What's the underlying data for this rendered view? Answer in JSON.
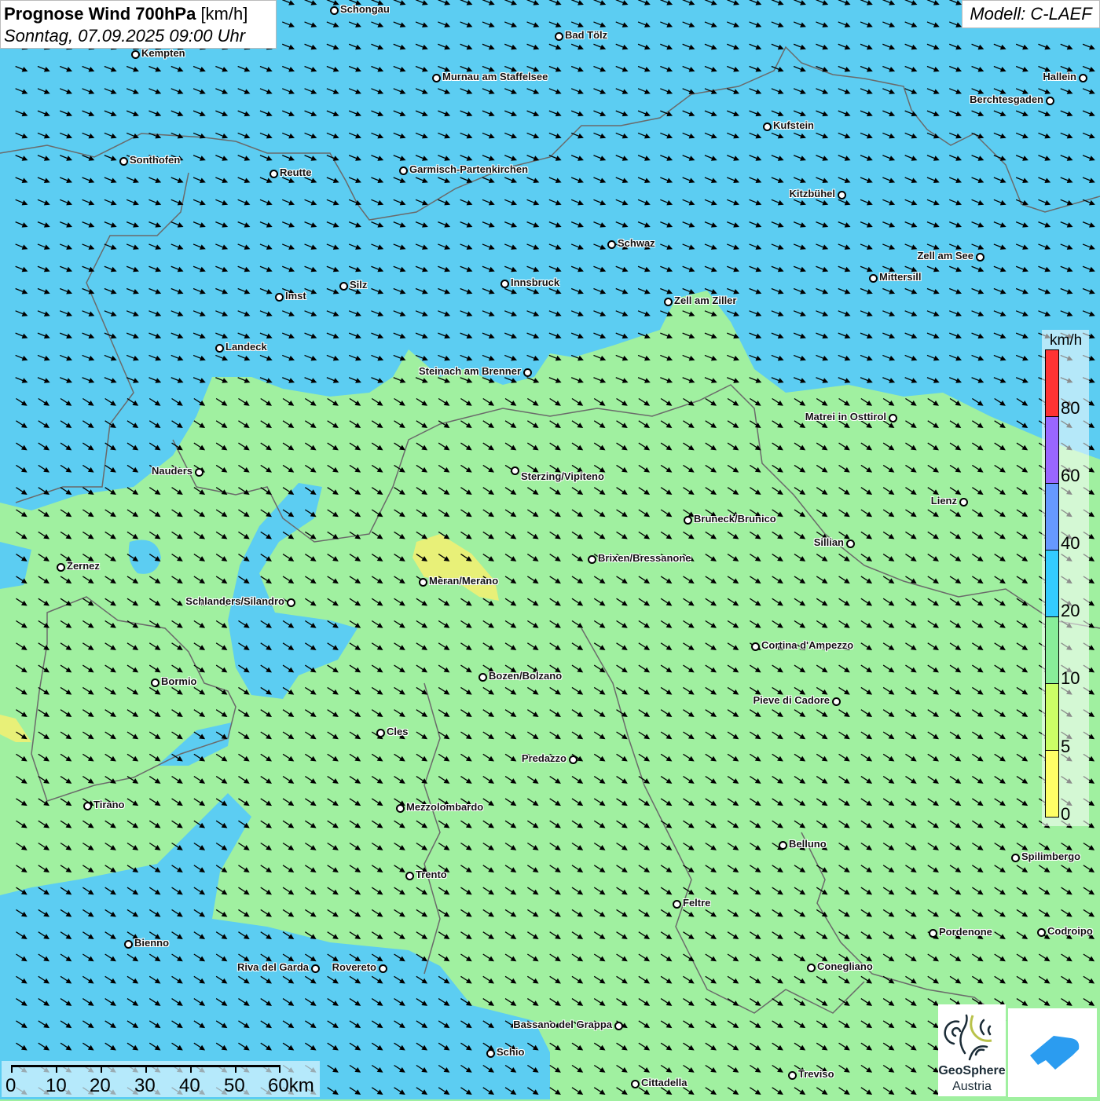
{
  "header": {
    "title_bold": "Prognose Wind 700hPa",
    "title_unit": "[km/h]",
    "datetime": "Sonntag, 07.09.2025 09:00 Uhr",
    "model": "Modell: C-LAEF"
  },
  "legend": {
    "unit": "km/h",
    "ticks": [
      "80",
      "60",
      "40",
      "20",
      "10",
      "5",
      "0"
    ],
    "colors": [
      "#ff3333",
      "#9966ff",
      "#6699ff",
      "#33ccff",
      "#88ee99",
      "#ccff66",
      "#ffff66"
    ]
  },
  "scale_bar": {
    "labels": [
      "0",
      "10",
      "20",
      "30",
      "40",
      "50",
      "60km"
    ]
  },
  "logos": {
    "geosphere_line1": "GeoSphere",
    "geosphere_line2": "Austria"
  },
  "colors": {
    "wind_low": "#a0f0a0",
    "wind_mid": "#5ccdf2",
    "wind_calm": "#eef080"
  },
  "cities": [
    "Schongau",
    "Bad Tölz",
    "Kempten",
    "Murnau am Staffelsee",
    "Hallein",
    "Berchtesgaden",
    "Kufstein",
    "Sonthofen",
    "Reutte",
    "Garmisch-Partenkirchen",
    "Kitzbühel",
    "Schwaz",
    "Zell am See",
    "Mittersill",
    "Innsbruck",
    "Silz",
    "Imst",
    "Zell am Ziller",
    "Landeck",
    "Steinach am Brenner",
    "Matrei in Osttirol",
    "Nauders",
    "Sterzing/Vipiteno",
    "Lienz",
    "Bruneck/Brunico",
    "Sillian",
    "Brixen/Bressanone",
    "Zernez",
    "Meran/Merano",
    "Schlanders/Silandro",
    "Cortina d'Ampezzo",
    "Bozen/Bolzano",
    "Bormio",
    "Pieve di Cadore",
    "Cles",
    "Predazzo",
    "Tirano",
    "Mezzolombardo",
    "Belluno",
    "Spilimbergo",
    "Trento",
    "Feltre",
    "Pordenone",
    "Codroipo",
    "Bienno",
    "Riva del Garda",
    "Rovereto",
    "Conegliano",
    "Bassano del Grappa",
    "Schio",
    "Treviso",
    "Cittadella"
  ]
}
